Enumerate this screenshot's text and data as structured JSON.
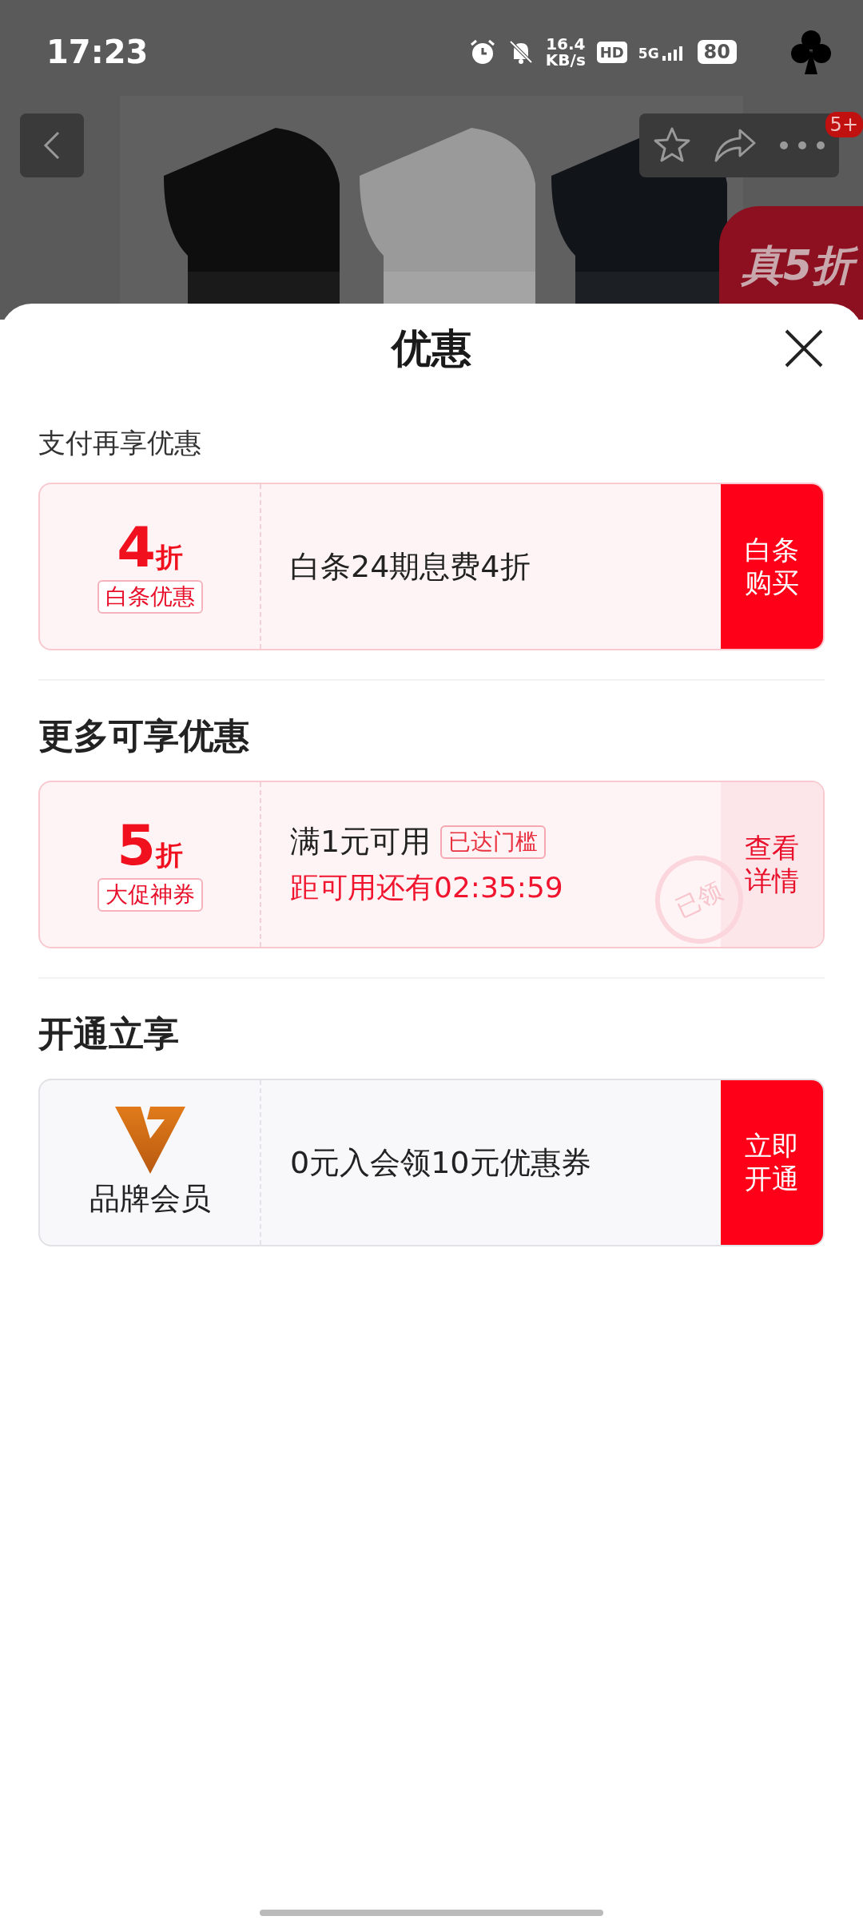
{
  "status_bar": {
    "time": "17:23",
    "net_speed": "16.4",
    "net_unit": "KB/s",
    "hd": "HD",
    "signal": "5G",
    "battery": "80"
  },
  "product": {
    "cart_badge": "5+",
    "promo": "真5折"
  },
  "sheet": {
    "title": "优惠",
    "sections": [
      {
        "kind": "subtitle",
        "title": "支付再享优惠",
        "cards": [
          {
            "kind": "discount",
            "value": "4",
            "unit": "折",
            "tag": "白条优惠",
            "text": "白条24期息费4折",
            "action": "白条购买"
          }
        ]
      },
      {
        "kind": "heading",
        "title": "更多可享优惠",
        "cards": [
          {
            "kind": "discount",
            "value": "5",
            "unit": "折",
            "tag": "大促神券",
            "text": "满1元可用",
            "badge": "已达门槛",
            "countdown": "距可用还有02:35:59",
            "action": "查看详情",
            "stamp": "已领"
          }
        ]
      },
      {
        "kind": "heading",
        "title": "开通立享",
        "cards": [
          {
            "kind": "member",
            "label": "品牌会员",
            "text": "0元入会领10元优惠券",
            "action": "立即开通"
          }
        ]
      }
    ]
  }
}
